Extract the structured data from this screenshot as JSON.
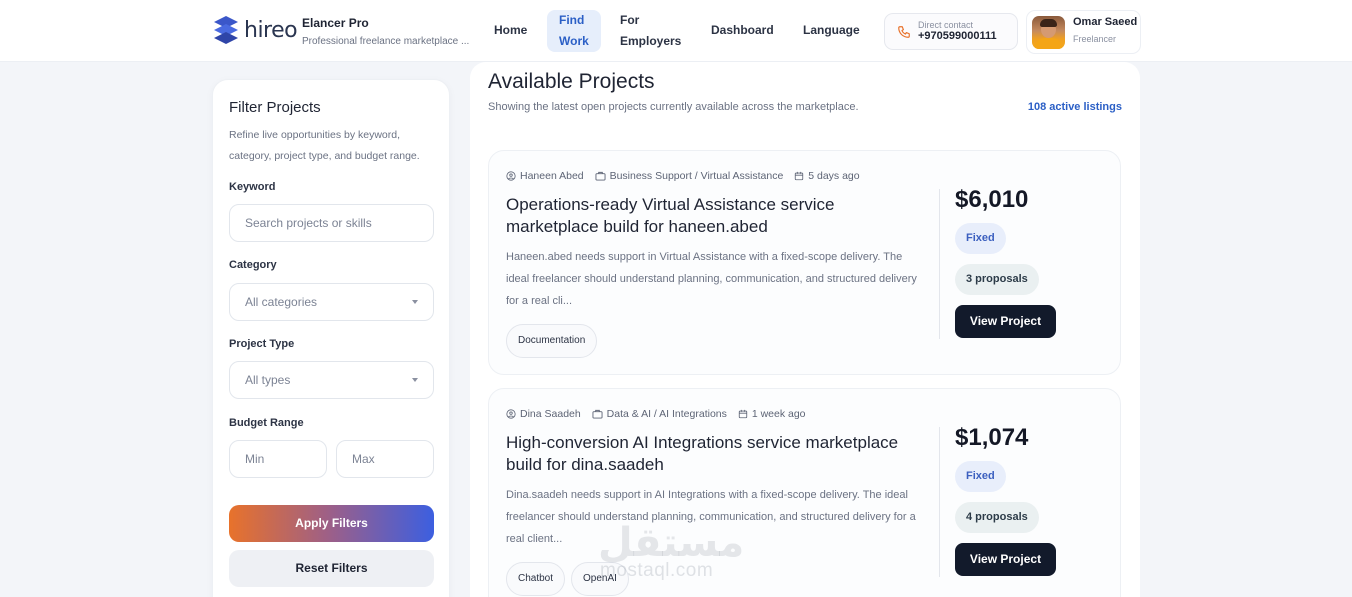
{
  "header": {
    "logo_text": "hireo",
    "brand_name": "Elancer Pro",
    "brand_subtitle": "Professional freelance marketplace ...",
    "nav": {
      "home": "Home",
      "find_work_1": "Find",
      "find_work_2": "Work",
      "for_employers_1": "For",
      "for_employers_2": "Employers",
      "dashboard": "Dashboard",
      "language": "Language"
    },
    "contact": {
      "label": "Direct contact",
      "value": "+970599000111"
    },
    "user": {
      "name": "Omar Saeed",
      "role": "Freelancer"
    }
  },
  "sidebar": {
    "title": "Filter Projects",
    "description": "Refine live opportunities by keyword, category, project type, and budget range.",
    "keyword_label": "Keyword",
    "keyword_placeholder": "Search projects or skills",
    "category_label": "Category",
    "category_value": "All categories",
    "type_label": "Project Type",
    "type_value": "All types",
    "budget_label": "Budget Range",
    "budget_min_placeholder": "Min",
    "budget_max_placeholder": "Max",
    "apply_label": "Apply Filters",
    "reset_label": "Reset Filters"
  },
  "main": {
    "title": "Available Projects",
    "subtitle": "Showing the latest open projects currently available across the marketplace.",
    "count": "108 active listings",
    "projects": [
      {
        "author": "Haneen Abed",
        "category": "Business Support / Virtual Assistance",
        "posted": "5 days ago",
        "title": "Operations-ready Virtual Assistance service marketplace build for haneen.abed",
        "description": "Haneen.abed needs support in Virtual Assistance with a fixed-scope delivery. The ideal freelancer should understand planning, communication, and structured delivery for a real cli...",
        "tags": [
          "Documentation"
        ],
        "price": "$6,010",
        "type": "Fixed",
        "proposals": "3 proposals",
        "view_label": "View Project"
      },
      {
        "author": "Dina Saadeh",
        "category": "Data & AI / AI Integrations",
        "posted": "1 week ago",
        "title": "High-conversion AI Integrations service marketplace build for dina.saadeh",
        "description": "Dina.saadeh needs support in AI Integrations with a fixed-scope delivery. The ideal freelancer should understand planning, communication, and structured delivery for a real client...",
        "tags": [
          "Chatbot",
          "OpenAI"
        ],
        "price": "$1,074",
        "type": "Fixed",
        "proposals": "4 proposals",
        "view_label": "View Project"
      }
    ]
  },
  "watermark": {
    "arabic": "مستقل",
    "latin": "mostaql.com"
  },
  "colors": {
    "accent_blue": "#2b5fc6",
    "dark_button": "#121a2b",
    "gradient_start": "#e8722b",
    "gradient_end": "#3c5fe0"
  }
}
